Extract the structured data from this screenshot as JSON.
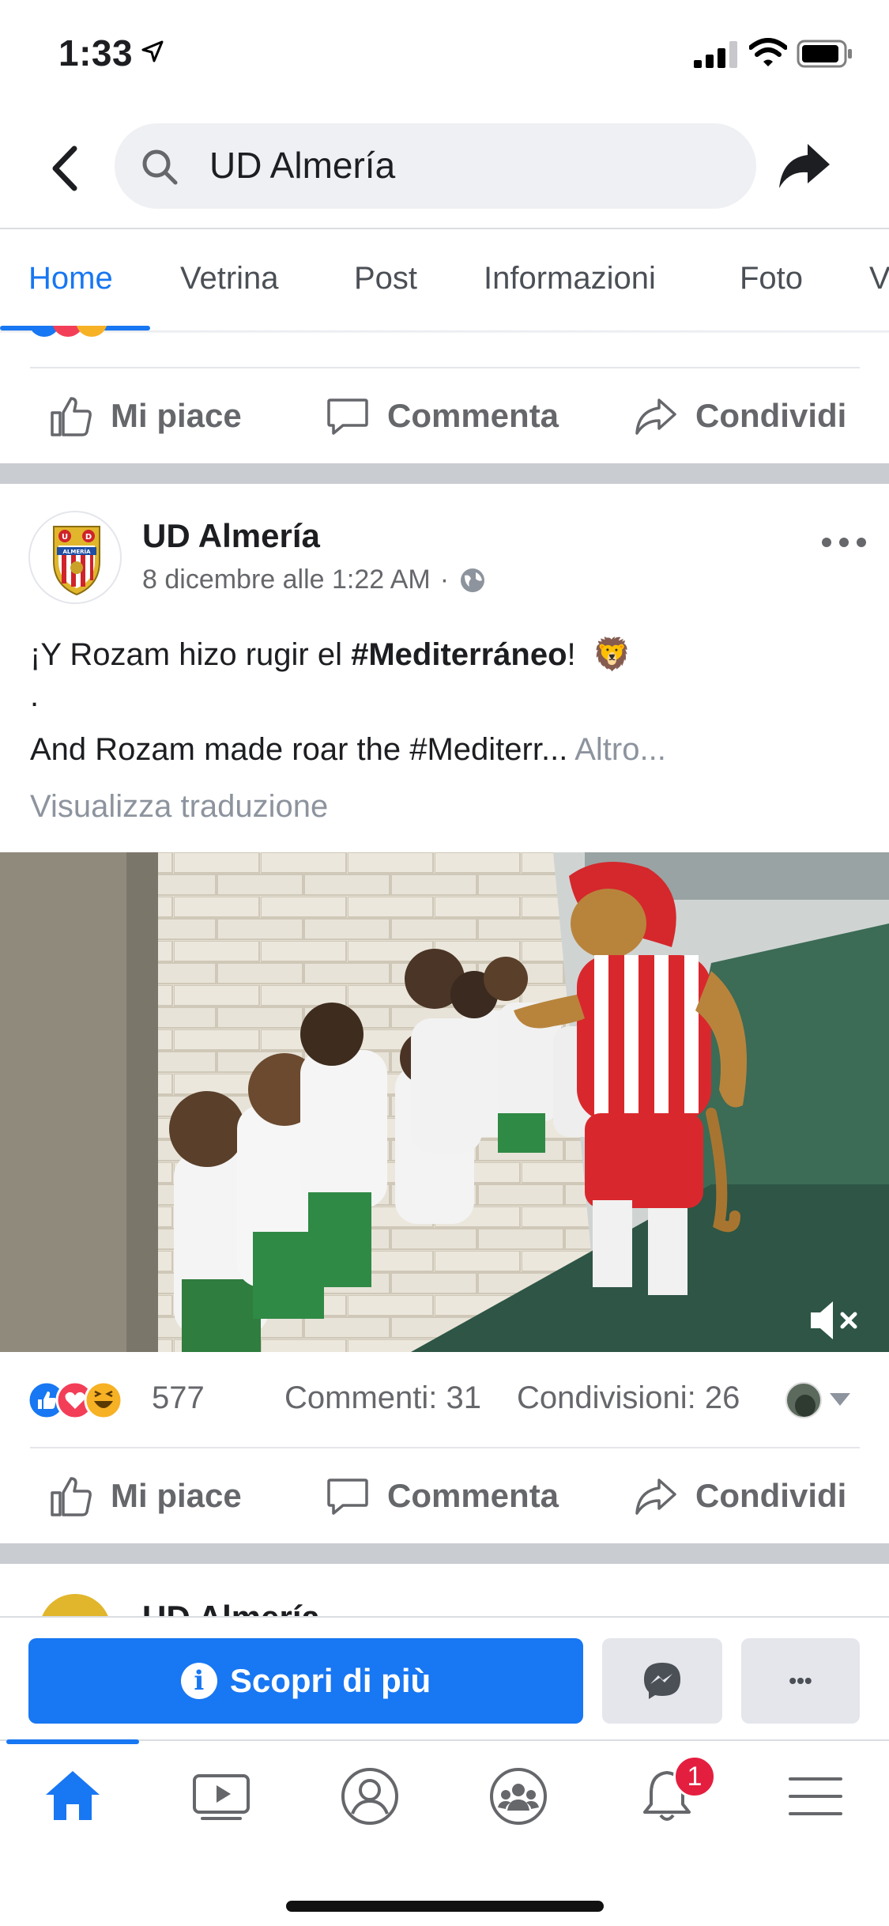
{
  "status_bar": {
    "time": "1:33"
  },
  "header": {
    "search_value": "UD Almería"
  },
  "tabs": [
    {
      "label": "Home"
    },
    {
      "label": "Vetrina"
    },
    {
      "label": "Post"
    },
    {
      "label": "Informazioni"
    },
    {
      "label": "Foto"
    },
    {
      "label": "V"
    }
  ],
  "actions": {
    "like": "Mi piace",
    "comment": "Commenta",
    "share": "Condividi"
  },
  "post": {
    "author": "UD Almería",
    "timestamp": "8 dicembre alle 1:22 AM",
    "meta_separator": "·",
    "line1_prefix": "¡Y Rozam hizo rugir el ",
    "line1_hashtag": "#Mediterráneo",
    "line1_suffix": "!",
    "line1_emoji": "🦁",
    "line2": ".",
    "line3": "And Rozam made roar the #Mediterr...",
    "more": "Altro...",
    "translate": "Visualizza traduzione",
    "reaction_count": "577",
    "comments": "Commenti: 31",
    "shares": "Condivisioni: 26"
  },
  "next_post": {
    "author": "UD Almería"
  },
  "logo": {
    "top_letters": "U D",
    "band": "ALMERÍA"
  },
  "cta": {
    "primary": "Scopri di più",
    "info_glyph": "i",
    "more_glyph": "•••"
  },
  "tabbar": {
    "notification_badge": "1"
  },
  "colors": {
    "accent": "#1877f2",
    "badge": "#e41e3f"
  }
}
